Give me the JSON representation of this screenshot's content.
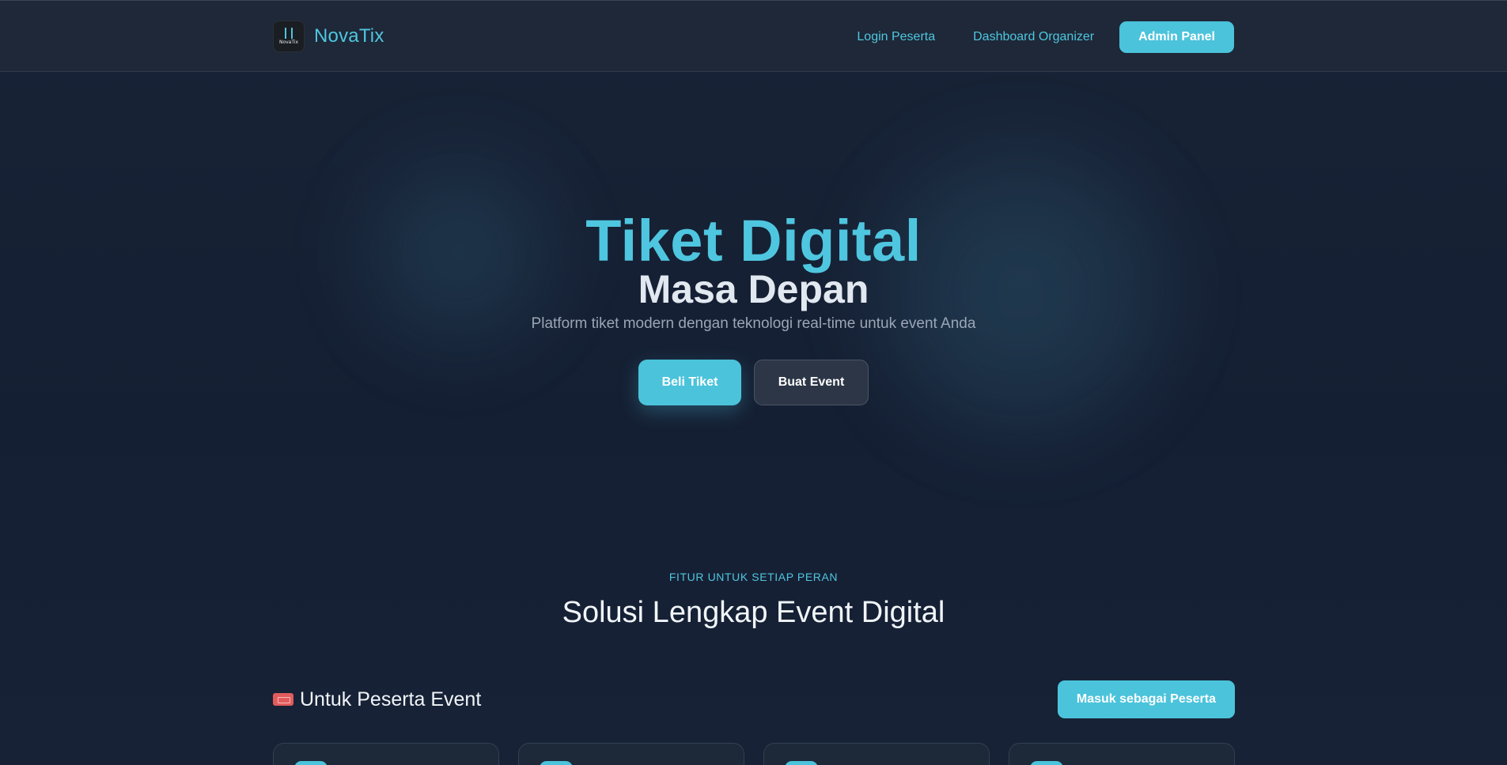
{
  "header": {
    "brand": {
      "logo_text": "NovaTix",
      "name": "NovaTix"
    },
    "nav": {
      "login_label": "Login Peserta",
      "dashboard_label": "Dashboard Organizer",
      "admin_label": "Admin Panel"
    }
  },
  "hero": {
    "title": "Tiket Digital",
    "subtitle": "Masa Depan",
    "description": "Platform tiket modern dengan teknologi real-time untuk event Anda",
    "primary_button": "Beli Tiket",
    "secondary_button": "Buat Event"
  },
  "features": {
    "eyebrow": "FITUR UNTUK SETIAP PERAN",
    "title": "Solusi Lengkap Event Digital",
    "role": {
      "title": "Untuk Peserta Event",
      "icon": "ticket-icon",
      "button": "Masuk sebagai Peserta"
    },
    "card_count": 4
  },
  "colors": {
    "accent": "#4bc3db",
    "background": "#162033",
    "header": "#1e2838",
    "text": "#f1f5f9",
    "muted": "#9aa6b6"
  }
}
